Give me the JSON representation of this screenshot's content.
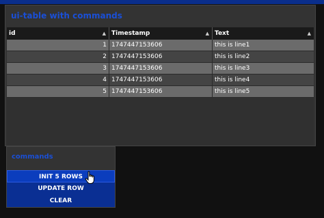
{
  "table_panel": {
    "title": "ui-table with commands",
    "columns": [
      {
        "label": "id",
        "sort": "▲"
      },
      {
        "label": "Timestamp",
        "sort": "▲"
      },
      {
        "label": "Text",
        "sort": "▲"
      }
    ],
    "rows": [
      {
        "id": "1",
        "timestamp": "1747447153606",
        "text": "this is line1"
      },
      {
        "id": "2",
        "timestamp": "1747447153606",
        "text": "this is line2"
      },
      {
        "id": "3",
        "timestamp": "1747447153606",
        "text": "this is line3"
      },
      {
        "id": "4",
        "timestamp": "1747447153606",
        "text": "this is line4"
      },
      {
        "id": "5",
        "timestamp": "1747447153606",
        "text": "this is line5"
      }
    ]
  },
  "commands_panel": {
    "title": "commands",
    "init_label": "INIT 5 ROWS",
    "update_label": "UPDATE ROW",
    "clear_label": "CLEAR"
  },
  "colors": {
    "accent": "#1a4fd6",
    "button": "#0a2f93",
    "topbar": "#0a2e8c"
  },
  "icons": {
    "cursor": "hand-pointer-icon",
    "sort": "sort-asc-icon"
  }
}
